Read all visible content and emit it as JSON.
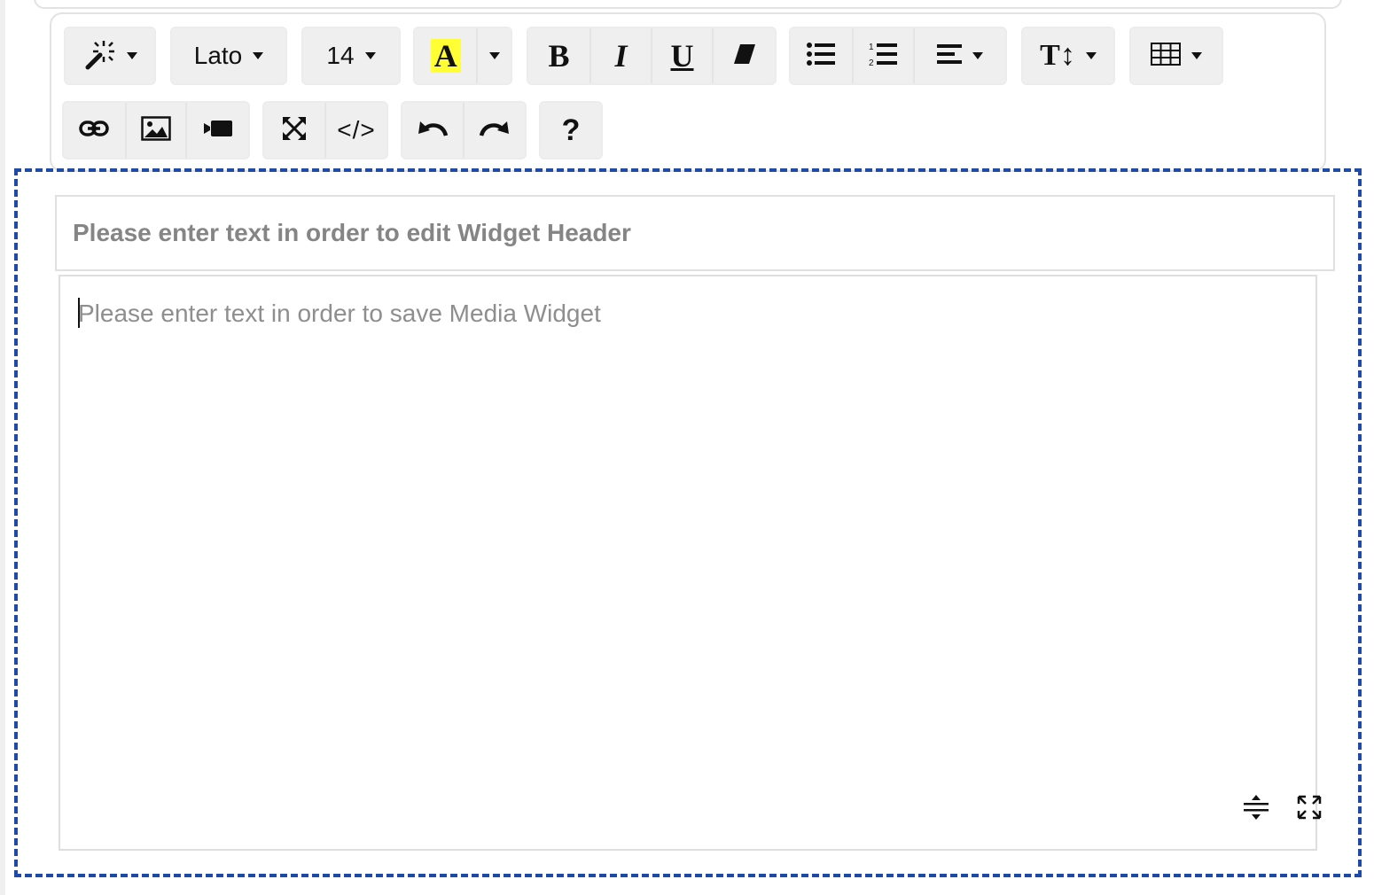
{
  "toolbar": {
    "font_name": "Lato",
    "font_size": "14",
    "highlight_letter": "A",
    "bold_label": "B",
    "italic_label": "I",
    "underline_label": "U",
    "text_height_label": "T↕",
    "code_label": "</>",
    "help_label": "?",
    "highlight_color": "#ffff33"
  },
  "editor": {
    "header_placeholder": "Please enter text in order to edit Widget Header",
    "body_placeholder": "Please enter text in order to save Media Widget",
    "frame_color": "#1f4aa8"
  },
  "icons": {
    "magic": "magic-wand-icon",
    "eraser": "eraser-icon",
    "bullets": "unordered-list-icon",
    "numbers": "ordered-list-icon",
    "align": "align-left-icon",
    "table": "table-icon",
    "link": "link-icon",
    "picture": "picture-icon",
    "video": "video-icon",
    "fullscreen": "fullscreen-icon",
    "undo": "undo-icon",
    "redo": "redo-icon",
    "resize": "resize-handle-icon",
    "expand": "expand-icon"
  }
}
